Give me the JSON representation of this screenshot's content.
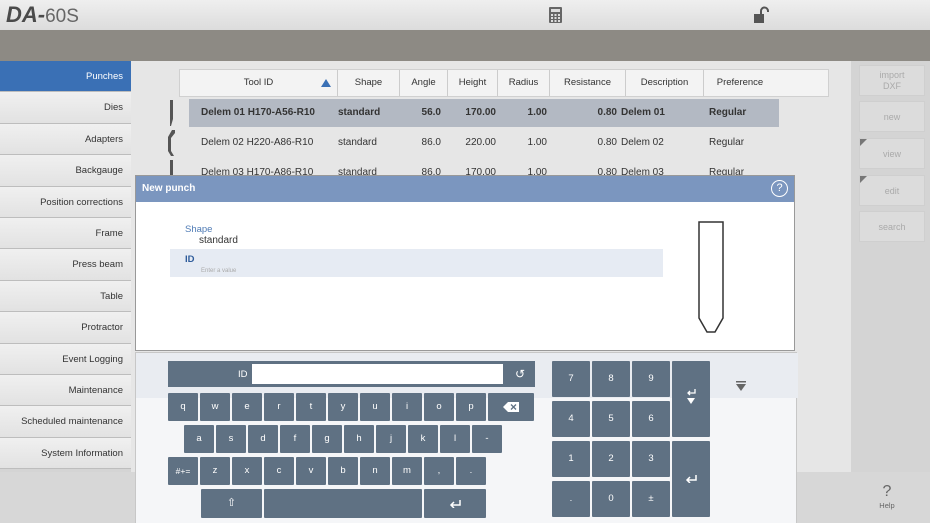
{
  "app": {
    "brand": "DA-",
    "model": "60S"
  },
  "header": {
    "calculator_icon": "calculator-icon",
    "lock_icon": "unlock-icon"
  },
  "sidebar": {
    "items": [
      {
        "label": "Punches",
        "active": true
      },
      {
        "label": "Dies"
      },
      {
        "label": "Adapters"
      },
      {
        "label": "Backgauge"
      },
      {
        "label": "Position corrections"
      },
      {
        "label": "Frame"
      },
      {
        "label": "Press beam"
      },
      {
        "label": "Table"
      },
      {
        "label": "Protractor"
      },
      {
        "label": "Event Logging"
      },
      {
        "label": "Maintenance"
      },
      {
        "label": "Scheduled maintenance"
      },
      {
        "label": "System Information"
      }
    ]
  },
  "table": {
    "columns": [
      "Tool ID",
      "Shape",
      "Angle",
      "Height",
      "Radius",
      "Resistance",
      "Description",
      "Preference"
    ],
    "rows": [
      {
        "id": "Delem 01 H170-A56-R10",
        "shape": "standard",
        "angle": "56.0",
        "height": "170.00",
        "radius": "1.00",
        "resistance": "0.80",
        "description": "Delem 01",
        "preference": "Regular",
        "selected": true
      },
      {
        "id": "Delem 02 H220-A86-R10",
        "shape": "standard",
        "angle": "86.0",
        "height": "220.00",
        "radius": "1.00",
        "resistance": "0.80",
        "description": "Delem 02",
        "preference": "Regular"
      },
      {
        "id": "Delem 03 H170-A86-R10",
        "shape": "standard",
        "angle": "86.0",
        "height": "170.00",
        "radius": "1.00",
        "resistance": "0.80",
        "description": "Delem 03",
        "preference": "Regular"
      }
    ]
  },
  "right_buttons": {
    "import_line1": "import",
    "import_line2": "DXF",
    "new": "new",
    "view": "view",
    "edit": "edit",
    "search": "search"
  },
  "help": {
    "label": "Help",
    "icon": "?"
  },
  "dialog": {
    "title": "New punch",
    "help_icon": "?",
    "shape_label": "Shape",
    "shape_value": "standard",
    "id_label": "ID",
    "id_placeholder": "Enter a value"
  },
  "keyboard": {
    "field_label": "ID",
    "field_value": "",
    "row1": [
      "q",
      "w",
      "e",
      "r",
      "t",
      "y",
      "u",
      "i",
      "o",
      "p"
    ],
    "row2": [
      "a",
      "s",
      "d",
      "f",
      "g",
      "h",
      "j",
      "k",
      "l",
      "-"
    ],
    "row3": [
      "#+=",
      "z",
      "x",
      "c",
      "v",
      "b",
      "n",
      "m",
      ",",
      "."
    ],
    "numpad": [
      "7",
      "8",
      "9",
      "4",
      "5",
      "6",
      "1",
      "2",
      "3",
      ".",
      "0",
      "±"
    ]
  }
}
